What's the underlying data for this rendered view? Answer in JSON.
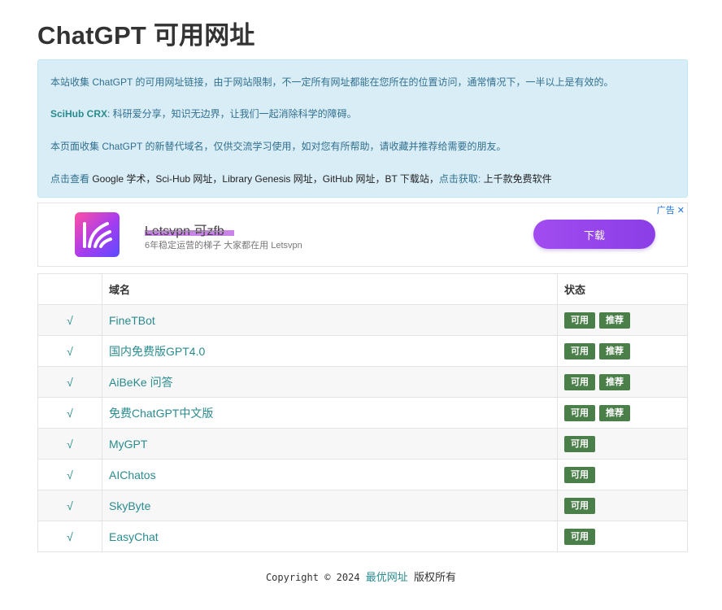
{
  "page": {
    "title": "ChatGPT 可用网址"
  },
  "info": {
    "line1": "本站收集 ChatGPT 的可用网址链接，由于网站限制，不一定所有网址都能在您所在的位置访问，通常情况下，一半以上是有效的。",
    "line2_bold": "SciHub CRX",
    "line2_rest": ": 科研爱分享，知识无边界，让我们一起消除科学的障碍。",
    "line3": "本页面收集 ChatGPT 的新替代域名，仅供交流学习使用，如对您有所帮助，请收藏并推荐给需要的朋友。",
    "line4_prefix": "点击查看",
    "line4_links": " Google 学术，Sci-Hub 网址，Library Genesis 网址，GitHub 网址，BT 下载站，",
    "line4_mid": "点击获取:",
    "line4_end": " 上千款免费软件"
  },
  "ad": {
    "title": "Letsvpn 可zfb",
    "subtitle": "6年稳定运营的梯子 大家都在用 Letsvpn",
    "button": "下载",
    "corner": "广告 ✕"
  },
  "table": {
    "headers": [
      "",
      "域名",
      "状态"
    ],
    "rows": [
      {
        "mark": "√",
        "name": "FineTBot",
        "status": "可用",
        "tag": "推荐"
      },
      {
        "mark": "√",
        "name": "国内免费版GPT4.0",
        "status": "可用",
        "tag": "推荐"
      },
      {
        "mark": "√",
        "name": "AiBeKe 问答",
        "status": "可用",
        "tag": "推荐"
      },
      {
        "mark": "√",
        "name": "免费ChatGPT中文版",
        "status": "可用",
        "tag": "推荐"
      },
      {
        "mark": "√",
        "name": "MyGPT",
        "status": "可用",
        "tag": ""
      },
      {
        "mark": "√",
        "name": "AIChatos",
        "status": "可用",
        "tag": ""
      },
      {
        "mark": "√",
        "name": "SkyByte",
        "status": "可用",
        "tag": ""
      },
      {
        "mark": "√",
        "name": "EasyChat",
        "status": "可用",
        "tag": ""
      }
    ]
  },
  "footer": {
    "copyright": "Copyright © 2024",
    "link": "最优网址",
    "rights": "版权所有"
  },
  "colors": {
    "accent": "#2a8b8e",
    "badge": "#4a7f4a",
    "info_bg": "#d9edf7",
    "ad_button": "#9b47ee"
  }
}
